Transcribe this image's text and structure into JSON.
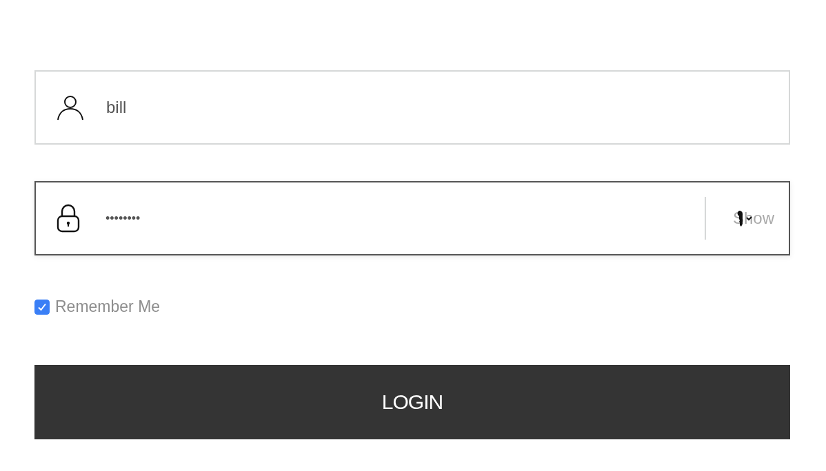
{
  "username": {
    "value": "bill"
  },
  "password": {
    "value": "••••••••",
    "toggle": "Show",
    "focused": true
  },
  "remember": {
    "label": "Remember Me",
    "checked": true
  },
  "login_button": {
    "label": "LOGIN"
  }
}
